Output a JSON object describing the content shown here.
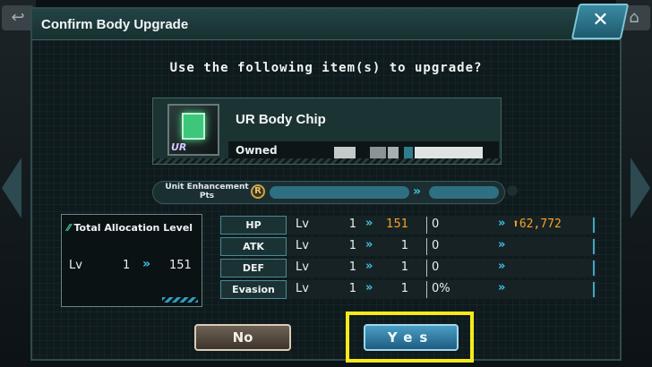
{
  "dialog": {
    "title": "Confirm Body Upgrade",
    "close_symbol": "✕",
    "prompt": "Use the following item(s) to upgrade?"
  },
  "item": {
    "name": "UR Body Chip",
    "rarity": "UR",
    "owned_label": "Owned",
    "icon": "body-chip-icon"
  },
  "points": {
    "label": "Unit Enhancement Pts",
    "coin_symbol": "R",
    "arrow": "»"
  },
  "allocation": {
    "title": "Total Allocation Level",
    "lv_label": "Lv",
    "current": "1",
    "new": "151",
    "arrow": "»"
  },
  "stats": [
    {
      "name": "HP",
      "lv": "Lv",
      "current": "1",
      "new": "151",
      "value": "0",
      "gain": "⬆62,772"
    },
    {
      "name": "ATK",
      "lv": "Lv",
      "current": "1",
      "new": "1",
      "value": "0",
      "gain": ""
    },
    {
      "name": "DEF",
      "lv": "Lv",
      "current": "1",
      "new": "1",
      "value": "0",
      "gain": ""
    },
    {
      "name": "Evasion",
      "lv": "Lv",
      "current": "1",
      "new": "1",
      "value": "0%",
      "gain": ""
    }
  ],
  "stat_arrow": "»",
  "buttons": {
    "no": "No",
    "yes": "Yes"
  },
  "colors": {
    "accent_cyan": "#41c1e6",
    "gain_gold": "#f5a623",
    "highlight": "#f6ea19"
  }
}
